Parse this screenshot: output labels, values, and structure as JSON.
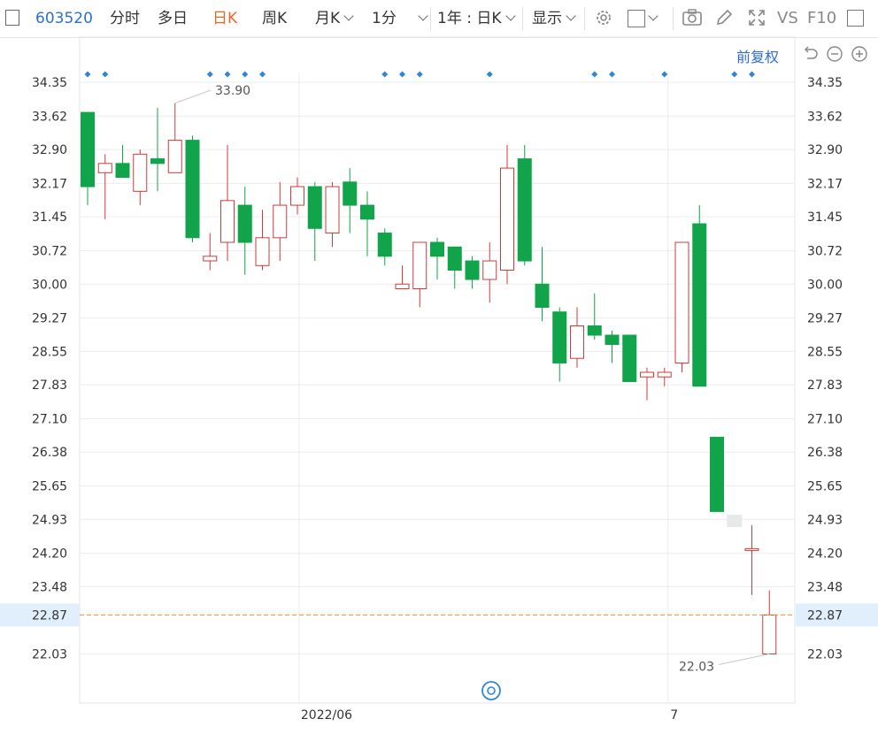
{
  "toolbar": {
    "code": "603520",
    "tabs": [
      "分时",
      "多日",
      "日K",
      "周K",
      "月K",
      "1分"
    ],
    "active_tab": "日K",
    "range_select": "1年 : 日K",
    "display_select": "显示",
    "vs_label": "VS",
    "f10_label": "F10"
  },
  "chart_controls": {
    "adjust_label": "前复权"
  },
  "colors": {
    "up": "#d03a3a",
    "down": "#11a44a",
    "accent": "#2f6fc4",
    "active_tab": "#e8682a",
    "current_line": "#f08a3c"
  },
  "chart_data": {
    "type": "candlestick",
    "y_ticks": [
      "34.35",
      "33.62",
      "32.90",
      "32.17",
      "31.45",
      "30.72",
      "30.00",
      "29.27",
      "28.55",
      "27.83",
      "27.10",
      "26.38",
      "25.65",
      "24.93",
      "24.20",
      "23.48",
      "22.03"
    ],
    "ylim": [
      21.5,
      34.35
    ],
    "current_price": "22.87",
    "x_labels": [
      "2022/06",
      "7"
    ],
    "max_label": "33.90",
    "min_label": "22.03",
    "grid": true,
    "candles": [
      {
        "o": 33.7,
        "c": 32.1,
        "h": 33.7,
        "l": 31.7
      },
      {
        "o": 32.4,
        "c": 32.6,
        "h": 32.8,
        "l": 31.4
      },
      {
        "o": 32.6,
        "c": 32.3,
        "h": 33.0,
        "l": 32.3
      },
      {
        "o": 32.0,
        "c": 32.8,
        "h": 32.9,
        "l": 31.7
      },
      {
        "o": 32.7,
        "c": 32.6,
        "h": 33.8,
        "l": 32.0
      },
      {
        "o": 32.4,
        "c": 33.1,
        "h": 33.9,
        "l": 32.4
      },
      {
        "o": 33.1,
        "c": 31.0,
        "h": 33.2,
        "l": 30.9
      },
      {
        "o": 30.5,
        "c": 30.6,
        "h": 31.1,
        "l": 30.3
      },
      {
        "o": 30.9,
        "c": 31.8,
        "h": 33.0,
        "l": 30.5
      },
      {
        "o": 31.7,
        "c": 30.9,
        "h": 32.1,
        "l": 30.2
      },
      {
        "o": 30.4,
        "c": 31.0,
        "h": 31.6,
        "l": 30.3
      },
      {
        "o": 31.0,
        "c": 31.7,
        "h": 32.2,
        "l": 30.5
      },
      {
        "o": 31.7,
        "c": 32.1,
        "h": 32.3,
        "l": 31.5
      },
      {
        "o": 32.1,
        "c": 31.2,
        "h": 32.2,
        "l": 30.5
      },
      {
        "o": 31.1,
        "c": 32.1,
        "h": 32.2,
        "l": 30.8
      },
      {
        "o": 32.2,
        "c": 31.7,
        "h": 32.5,
        "l": 31.1
      },
      {
        "o": 31.7,
        "c": 31.4,
        "h": 32.0,
        "l": 30.6
      },
      {
        "o": 31.1,
        "c": 30.6,
        "h": 31.2,
        "l": 30.4
      },
      {
        "o": 29.9,
        "c": 30.0,
        "h": 30.4,
        "l": 29.9
      },
      {
        "o": 29.9,
        "c": 30.9,
        "h": 30.9,
        "l": 29.5
      },
      {
        "o": 30.9,
        "c": 30.6,
        "h": 31.0,
        "l": 30.1
      },
      {
        "o": 30.8,
        "c": 30.3,
        "h": 30.8,
        "l": 29.9
      },
      {
        "o": 30.5,
        "c": 30.1,
        "h": 30.6,
        "l": 29.9
      },
      {
        "o": 30.1,
        "c": 30.5,
        "h": 30.9,
        "l": 29.6
      },
      {
        "o": 30.3,
        "c": 32.5,
        "h": 33.0,
        "l": 30.0
      },
      {
        "o": 32.7,
        "c": 30.5,
        "h": 33.0,
        "l": 30.4
      },
      {
        "o": 30.0,
        "c": 29.5,
        "h": 30.8,
        "l": 29.2
      },
      {
        "o": 29.4,
        "c": 28.3,
        "h": 29.5,
        "l": 27.9
      },
      {
        "o": 28.4,
        "c": 29.1,
        "h": 29.5,
        "l": 28.2
      },
      {
        "o": 29.1,
        "c": 28.9,
        "h": 29.8,
        "l": 28.8
      },
      {
        "o": 28.9,
        "c": 28.7,
        "h": 29.0,
        "l": 28.3
      },
      {
        "o": 28.9,
        "c": 27.9,
        "h": 28.9,
        "l": 27.9
      },
      {
        "o": 28.0,
        "c": 28.1,
        "h": 28.2,
        "l": 27.5
      },
      {
        "o": 28.0,
        "c": 28.1,
        "h": 28.2,
        "l": 27.8
      },
      {
        "o": 28.3,
        "c": 30.9,
        "h": 30.9,
        "l": 28.1
      },
      {
        "o": 31.3,
        "c": 27.8,
        "h": 31.7,
        "l": 27.8
      },
      {
        "o": 26.7,
        "c": 25.1,
        "h": 26.7,
        "l": 25.1
      },
      {
        "o": 24.9,
        "c": 24.9,
        "h": 24.9,
        "l": 24.9
      },
      {
        "o": 24.3,
        "c": 24.3,
        "h": 24.8,
        "l": 23.3
      },
      {
        "o": 22.03,
        "c": 22.87,
        "h": 23.4,
        "l": 22.03
      }
    ],
    "event_markers": [
      0,
      1,
      7,
      8,
      9,
      10,
      17,
      18,
      19,
      23,
      29,
      30,
      33,
      37,
      38
    ]
  }
}
